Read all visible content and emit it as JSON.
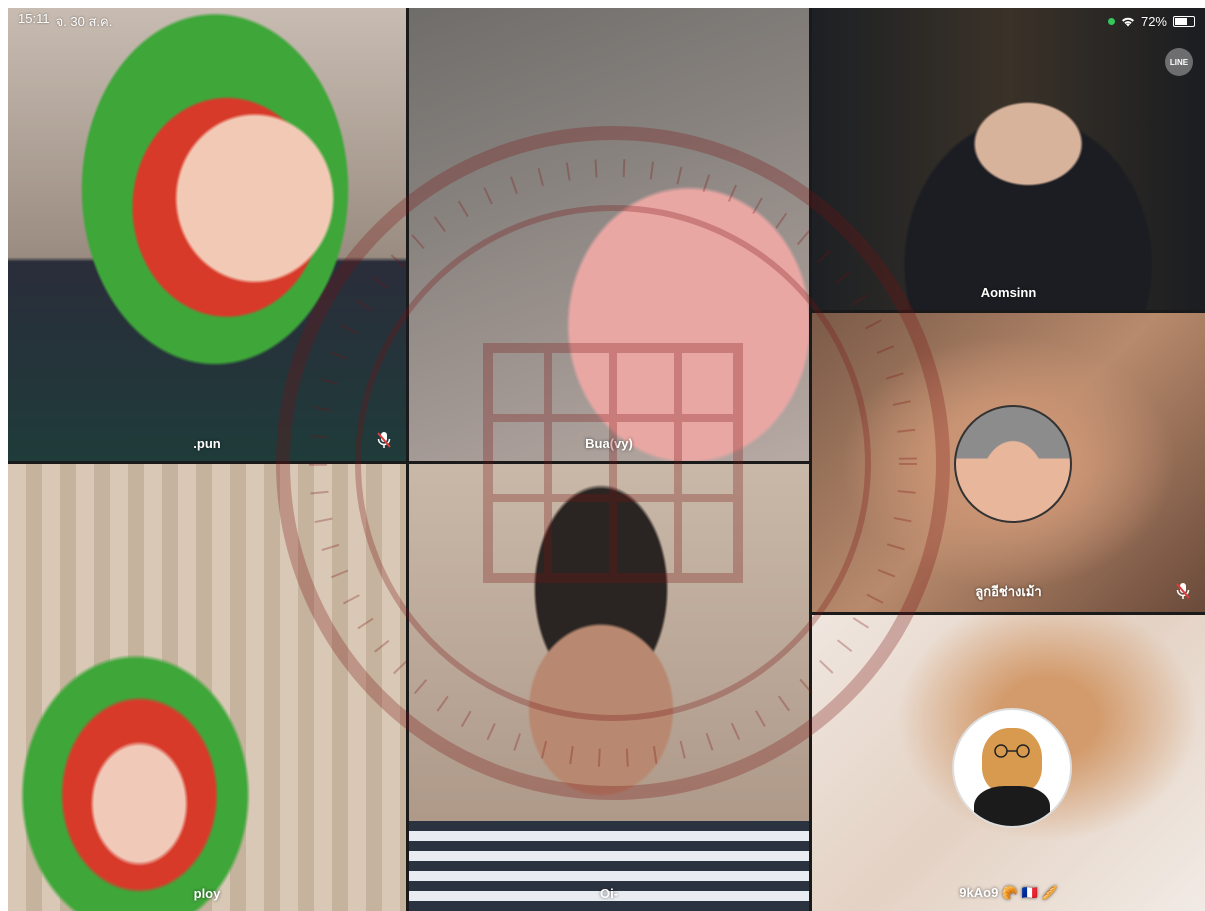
{
  "status": {
    "time": "15:11",
    "date": "จ. 30 ส.ค.",
    "battery": "72%",
    "battery_level": 0.72
  },
  "app": {
    "logo_text": "LINE"
  },
  "participants": [
    {
      "name": ".pun",
      "muted": true
    },
    {
      "name": "Bua(vy)",
      "muted": false
    },
    {
      "name": "Aomsinn",
      "muted": false
    },
    {
      "name": "ลูกอีช่างเม้า",
      "muted": true
    },
    {
      "name": "ploy",
      "muted": false
    },
    {
      "name": "Oi-",
      "muted": false
    },
    {
      "name": "9kAo9 🥐 🇫🇷 🥖",
      "muted": false
    }
  ],
  "colors": {
    "grid_gap": "#1a1a1a",
    "label": "#ffffff",
    "watermark": "#7a1010",
    "status_green": "#34c759"
  }
}
